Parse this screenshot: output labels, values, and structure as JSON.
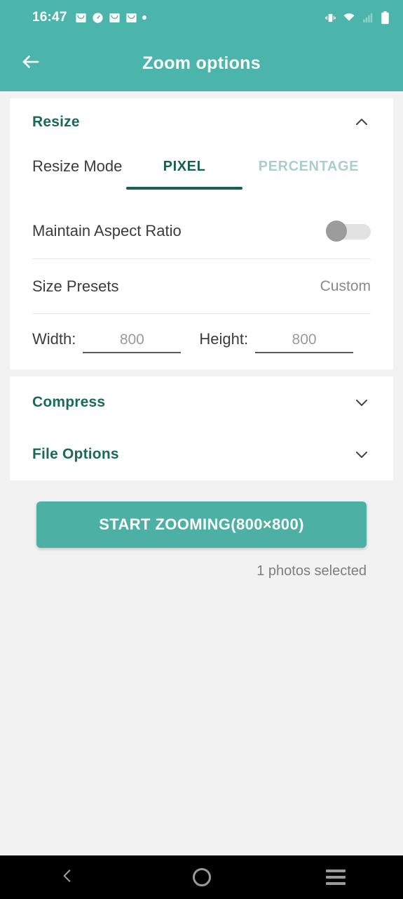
{
  "status_bar": {
    "time": "16:47",
    "left_icons": [
      "mail-icon",
      "clock-icon",
      "mail-icon",
      "mail-icon",
      "dot-icon"
    ],
    "right_icons": [
      "vibrate-icon",
      "wifi-icon",
      "signal-icon",
      "battery-icon"
    ]
  },
  "app_bar": {
    "back_icon": "arrow-left-icon",
    "title": "Zoom options"
  },
  "colors": {
    "accent": "#4cb5ab",
    "button": "#4cb0a5",
    "section_title": "#1a6b56",
    "tab_active": "#17614f",
    "tab_inactive": "#a9cfc8",
    "page_background": "#f2f2f2",
    "card_background": "#ffffff"
  },
  "resize_section": {
    "title": "Resize",
    "expanded": true,
    "chevron_icon": "chevron-up-icon",
    "resize_mode": {
      "label": "Resize Mode",
      "tabs": [
        {
          "label": "PIXEL",
          "active": true
        },
        {
          "label": "PERCENTAGE",
          "active": false
        }
      ]
    },
    "maintain_aspect_ratio": {
      "label": "Maintain Aspect Ratio",
      "enabled": false
    },
    "size_presets": {
      "label": "Size Presets",
      "value": "Custom"
    },
    "dimensions": {
      "width_label": "Width:",
      "width_value": "800",
      "width_placeholder": "800",
      "height_label": "Height:",
      "height_value": "800",
      "height_placeholder": "800"
    }
  },
  "compress_section": {
    "title": "Compress",
    "expanded": false,
    "chevron_icon": "chevron-down-icon"
  },
  "file_options_section": {
    "title": "File Options",
    "expanded": false,
    "chevron_icon": "chevron-down-icon"
  },
  "action": {
    "button_label": "START ZOOMING(800×800)",
    "selected_count_text": "1 photos selected"
  },
  "nav_bar": {
    "back_icon": "chevron-left-icon",
    "home_icon": "circle-icon",
    "recents_icon": "menu-icon"
  }
}
